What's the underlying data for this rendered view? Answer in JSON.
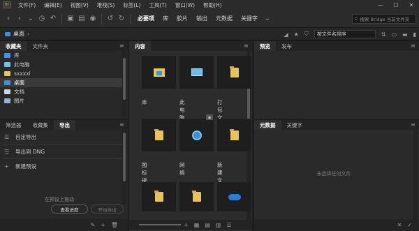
{
  "menubar": {
    "logo": "Br",
    "items": [
      "文件(F)",
      "编辑(E)",
      "视图(V)",
      "堆栈(S)",
      "标签(L)",
      "工具(T)",
      "窗口(W)",
      "帮助(H)"
    ]
  },
  "toolbar": {
    "workspaces": [
      "必要项",
      "库",
      "胶片",
      "输出",
      "元数据",
      "关键字"
    ],
    "search_placeholder": "搜索 Bridge 当前文件夹"
  },
  "pathbar": {
    "path": "桌面",
    "sort_label": "按文件名排序"
  },
  "favorites_panel": {
    "tabs": [
      "收藏夹",
      "文件夹"
    ],
    "items": [
      {
        "label": "库",
        "color": "#4a90e2"
      },
      {
        "label": "此电脑",
        "color": "#6cc0f0"
      },
      {
        "label": "sxxxxl",
        "color": "#e8c25a"
      },
      {
        "label": "桌面",
        "color": "#3d8fe0",
        "selected": true
      },
      {
        "label": "文档",
        "color": "#cfd6de"
      },
      {
        "label": "图片",
        "color": "#8fb3d9"
      }
    ]
  },
  "export_panel": {
    "tabs": [
      "筛选器",
      "收藏集",
      "导出"
    ],
    "rows": [
      {
        "icon": "☰",
        "label": "自定导出"
      },
      {
        "icon": "☰",
        "label": "导出到 DNG"
      },
      {
        "icon": "+",
        "label": "新建预设"
      }
    ],
    "hint": "在预设上拖动",
    "view_progress": "查看进度",
    "start_export": "开始导出"
  },
  "content_panel": {
    "tab": "内容",
    "items": [
      {
        "label": "库",
        "type": "library"
      },
      {
        "label": "此电脑",
        "type": "computer"
      },
      {
        "label": "打包文件",
        "type": "folder"
      },
      {
        "label": "图标提取",
        "type": "folder"
      },
      {
        "label": "网络",
        "type": "network"
      },
      {
        "label": "新建文件夹",
        "type": "folder"
      },
      {
        "label": "",
        "type": "folder"
      },
      {
        "label": "",
        "type": "folder"
      },
      {
        "label": "",
        "type": "cloud"
      }
    ]
  },
  "preview_panel": {
    "tabs": [
      "预览",
      "发布"
    ]
  },
  "metadata_panel": {
    "tabs": [
      "元数据",
      "关键字"
    ],
    "empty_text": "未选择任何文件"
  }
}
